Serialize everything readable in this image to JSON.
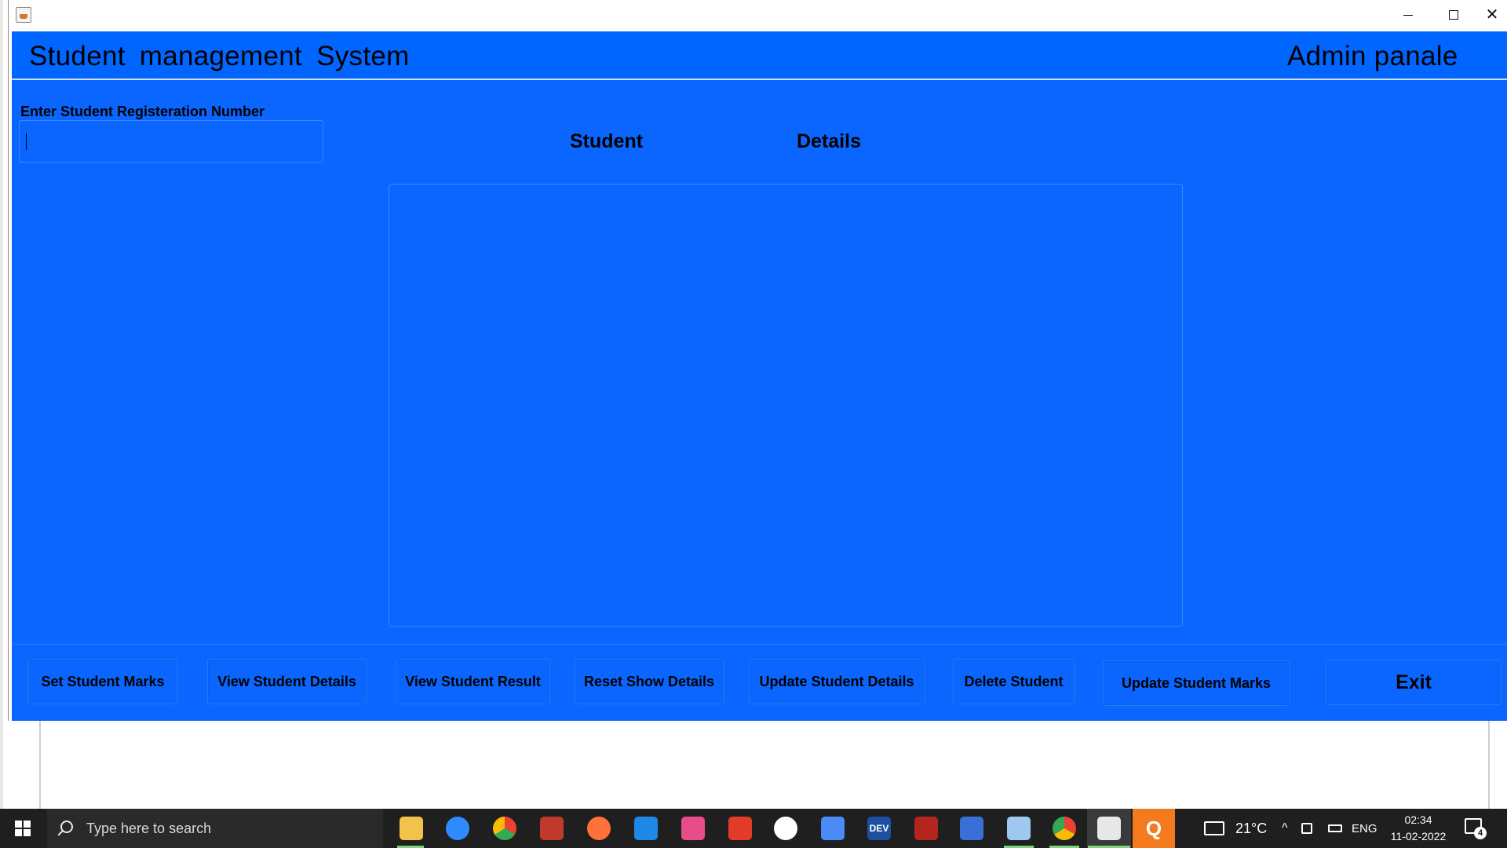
{
  "window": {
    "minimize_glyph": "",
    "close_glyph": "✕"
  },
  "header": {
    "app_title": "Student  management  System",
    "panel_title": "Admin panale"
  },
  "form": {
    "reg_label": "Enter Student Registeration Number",
    "reg_value": ""
  },
  "details": {
    "heading_word1": "Student",
    "heading_word2": "Details"
  },
  "buttons": {
    "set_marks": "Set Student Marks",
    "view_details": "View Student Details",
    "view_result": "View Student Result",
    "reset": "Reset Show Details",
    "update_details": "Update Student Details",
    "delete": "Delete Student",
    "update_marks": "Update Student Marks",
    "exit": "Exit"
  },
  "taskbar": {
    "search_placeholder": "Type here to search",
    "weather": "21°C",
    "language": "ENG",
    "time": "02:34",
    "date": "11-02-2022",
    "notification_count": "4",
    "dev_label": "DEV",
    "q_label": "Q"
  },
  "colors": {
    "app_blue": "#0a66ff",
    "taskbar": "#1f1f1f"
  }
}
